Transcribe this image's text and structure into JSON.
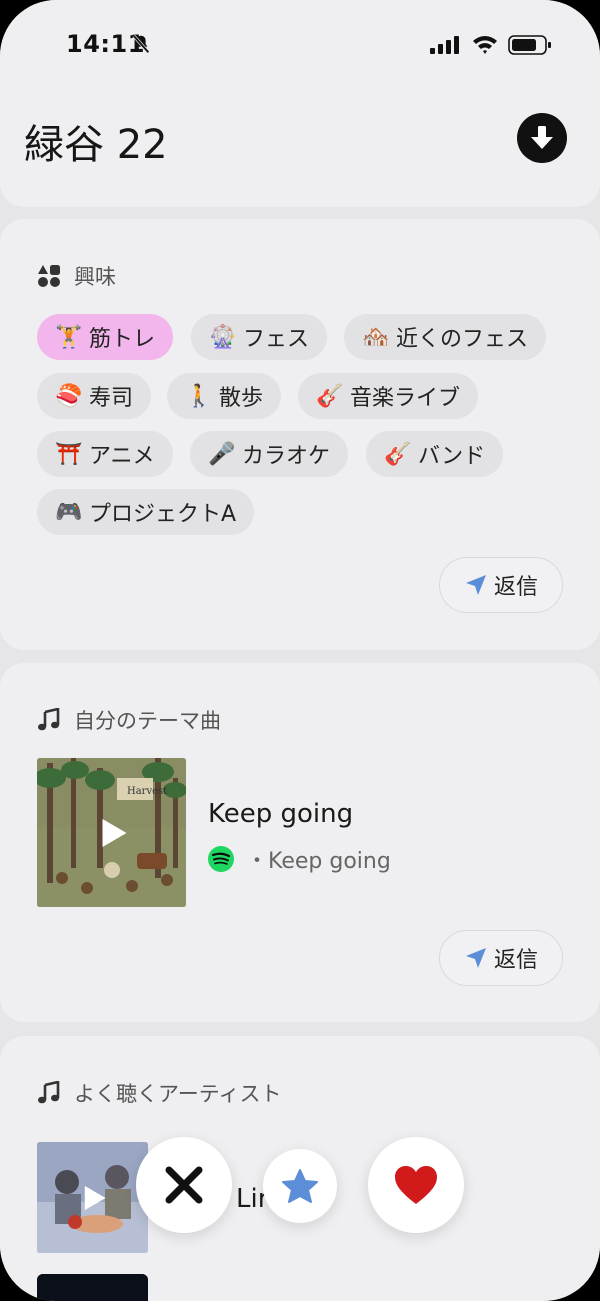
{
  "status_bar": {
    "time": "14:11"
  },
  "header": {
    "name": "緑谷 22"
  },
  "interests": {
    "title": "興味",
    "chips": [
      {
        "emoji": "🏋️",
        "label": "筋トレ",
        "selected": true
      },
      {
        "emoji": "🎡",
        "label": "フェス",
        "selected": false
      },
      {
        "emoji": "🏘️",
        "label": "近くのフェス",
        "selected": false
      },
      {
        "emoji": "🍣",
        "label": "寿司",
        "selected": false
      },
      {
        "emoji": "🚶",
        "label": "散歩",
        "selected": false
      },
      {
        "emoji": "🎸",
        "label": "音楽ライブ",
        "selected": false
      },
      {
        "emoji": "⛩️",
        "label": "アニメ",
        "selected": false
      },
      {
        "emoji": "🎤",
        "label": "カラオケ",
        "selected": false
      },
      {
        "emoji": "🎸",
        "label": "バンド",
        "selected": false
      },
      {
        "emoji": "🎮",
        "label": "プロジェクトA",
        "selected": false
      }
    ],
    "reply_label": "返信"
  },
  "theme_song": {
    "title": "自分のテーマ曲",
    "album_text": "Harvest",
    "song_title": "Keep going",
    "song_sub": "・Keep going",
    "reply_label": "返信"
  },
  "artists": {
    "title": "よく聴くアーティスト",
    "artist_name": "Lin    Saz"
  },
  "colors": {
    "selected_chip": "#f2b6ec",
    "chip": "#e2e1e3",
    "card": "#efeef0",
    "reply_icon": "#5b8ed6",
    "like": "#d11a1a",
    "star": "#5b8ed6",
    "spotify": "#1ed760"
  },
  "icons": {
    "download": "download-icon",
    "interests": "shapes-icon",
    "music": "music-note-icon",
    "reply": "send-icon",
    "pass": "close-icon",
    "super_like": "star-icon",
    "like": "heart-icon"
  }
}
